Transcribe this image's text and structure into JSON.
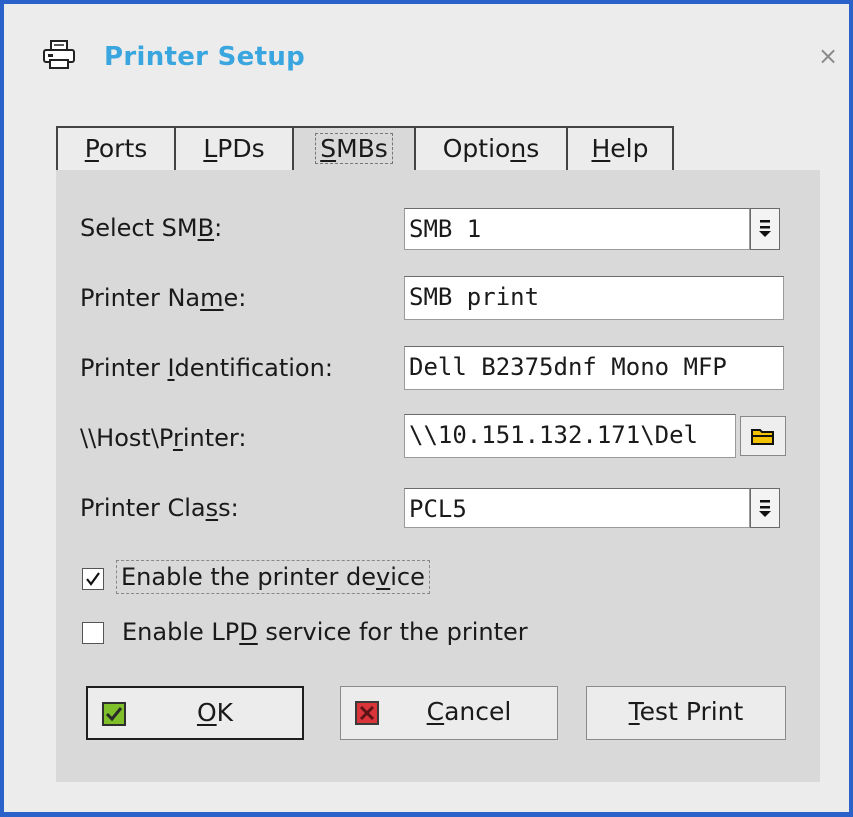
{
  "window": {
    "title": "Printer Setup",
    "icon": "printer-icon",
    "close_glyph": "×"
  },
  "tabs": [
    {
      "pre": "",
      "key": "P",
      "post": "orts",
      "active": false
    },
    {
      "pre": "",
      "key": "L",
      "post": "PDs",
      "active": false
    },
    {
      "pre": "",
      "key": "S",
      "post": "MBs",
      "active": true
    },
    {
      "pre": "Optio",
      "key": "n",
      "post": "s",
      "active": false
    },
    {
      "pre": "",
      "key": "H",
      "post": "elp",
      "active": false
    }
  ],
  "form": {
    "select_smb": {
      "label_pre": "Select SM",
      "label_key": "B",
      "label_post": ":",
      "value": "SMB 1"
    },
    "printer_name": {
      "label_pre": "Printer Na",
      "label_key": "m",
      "label_post": "e:",
      "value": "SMB print"
    },
    "printer_identification": {
      "label_pre": "Printer ",
      "label_key": "I",
      "label_post": "dentification:",
      "value": "Dell B2375dnf Mono MFP"
    },
    "host_printer": {
      "label_pre": "\\\\Host\\P",
      "label_key": "r",
      "label_post": "inter:",
      "value": "\\\\10.151.132.171\\Del"
    },
    "printer_class": {
      "label_pre": "Printer Cla",
      "label_key": "s",
      "label_post": "s:",
      "value": "PCL5"
    }
  },
  "checkboxes": {
    "enable_device": {
      "label_pre": "Enable the printer de",
      "label_key": "v",
      "label_post": "ice",
      "checked": true
    },
    "enable_lpd": {
      "label_pre": "Enable LP",
      "label_key": "D",
      "label_post": " service for the printer",
      "checked": false
    }
  },
  "buttons": {
    "ok": {
      "pre": "",
      "key": "O",
      "post": "K",
      "icon": "check-icon"
    },
    "cancel": {
      "pre": "",
      "key": "C",
      "post": "ancel",
      "icon": "x-icon"
    },
    "test_print": {
      "pre": "",
      "key": "T",
      "post": "est Print"
    }
  },
  "colors": {
    "frame": "#2a62c9",
    "title": "#3aa6df",
    "ok_icon": "#7fbf2a",
    "cancel_icon": "#d9343a"
  }
}
